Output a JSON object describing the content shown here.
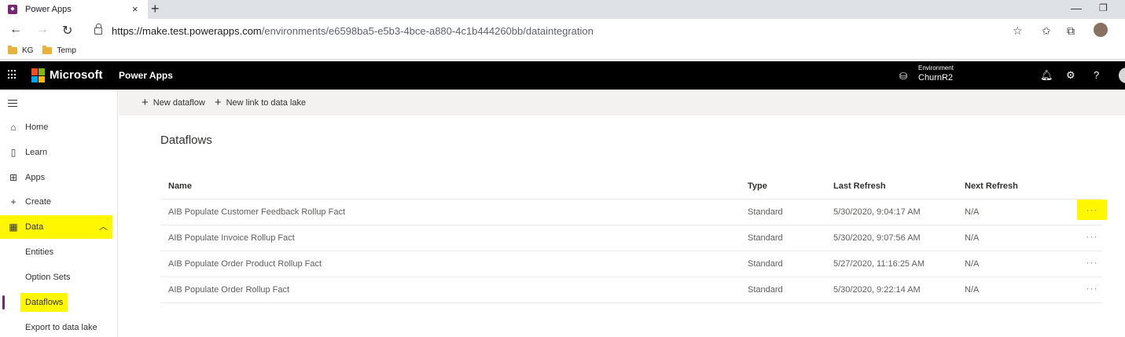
{
  "browser": {
    "tab_title": "Power Apps",
    "tab_close": "×",
    "new_tab": "+",
    "url_host": "https://make.test.powerapps.com",
    "url_path": "/environments/e6598ba5-e5b3-4bce-a880-4c1b444260bb/dataintegration",
    "favorites": [
      "KG",
      "Temp"
    ]
  },
  "header": {
    "brand": "Microsoft",
    "app_name": "Power Apps",
    "environment_label": "Environment",
    "environment_value": "ChurnR2"
  },
  "sidebar": {
    "items": [
      {
        "label": "Home",
        "icon": "home-icon"
      },
      {
        "label": "Learn",
        "icon": "book-icon"
      },
      {
        "label": "Apps",
        "icon": "apps-icon"
      },
      {
        "label": "Create",
        "icon": "plus-icon"
      },
      {
        "label": "Data",
        "icon": "table-icon"
      },
      {
        "label": "Entities"
      },
      {
        "label": "Option Sets"
      },
      {
        "label": "Dataflows"
      },
      {
        "label": "Export to data lake"
      }
    ]
  },
  "commands": {
    "new_dataflow": "New dataflow",
    "new_link": "New link to data lake"
  },
  "page": {
    "title": "Dataflows"
  },
  "table": {
    "columns": [
      "Name",
      "Type",
      "Last Refresh",
      "Next Refresh"
    ],
    "rows": [
      {
        "name": "AIB Populate Customer Feedback Rollup Fact",
        "type": "Standard",
        "last_refresh": "5/30/2020, 9:04:17 AM",
        "next_refresh": "N/A"
      },
      {
        "name": "AIB Populate Invoice Rollup Fact",
        "type": "Standard",
        "last_refresh": "5/30/2020, 9:07:56 AM",
        "next_refresh": "N/A"
      },
      {
        "name": "AIB Populate Order Product Rollup Fact",
        "type": "Standard",
        "last_refresh": "5/27/2020, 11:16:25 AM",
        "next_refresh": "N/A"
      },
      {
        "name": "AIB Populate Order Rollup Fact",
        "type": "Standard",
        "last_refresh": "5/30/2020, 9:22:14 AM",
        "next_refresh": "N/A"
      }
    ],
    "more_label": "···"
  },
  "colors": {
    "highlight": "#fff700",
    "accent": "#742774",
    "header_bg": "#000000"
  }
}
